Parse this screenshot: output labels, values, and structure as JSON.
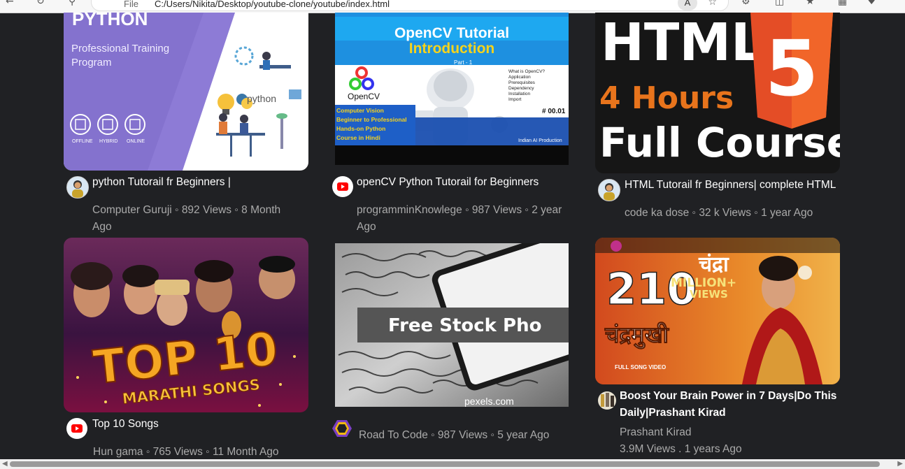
{
  "browser": {
    "file_label": "File",
    "url": "C:/Users/Nikita/Desktop/youtube-clone/youtube/index.html",
    "reader_label": "A"
  },
  "videos": [
    {
      "thumb_text": [
        "PYTHON",
        "Professional Training",
        "Program",
        "python",
        "OFFLINE",
        "HYBRID",
        "ONLINE"
      ],
      "title": "python Tutorail fr Beginners |",
      "meta": "Computer Guruji ◦ 892 Views ◦ 8 Month Ago"
    },
    {
      "thumb_text": [
        "OpenCV Tutorial",
        "Introduction",
        "Part - 1",
        "OpenCV",
        "Computer Vision",
        "Beginner to Professional",
        "Hands-on Python",
        "Course in Hindi",
        "What is OpenCV?",
        "Application",
        "Prerequisites",
        "Dependency",
        "Installation",
        "Import",
        "# 00.01",
        "Indian AI Production"
      ],
      "title": "openCV Python Tutorail for Beginners",
      "meta": "programminKnowlege ◦ 987 Views ◦ 2 year Ago"
    },
    {
      "thumb_text": [
        "HTML",
        "5",
        "4 Hours",
        "Full Course"
      ],
      "title": "HTML Tutorail fr Beginners| complete HTML",
      "meta": "code ka dose ◦ 32 k Views ◦ 1 year Ago"
    },
    {
      "thumb_text": [
        "TOP 10",
        "MARATHI SONGS"
      ],
      "title": "Top 10 Songs",
      "meta": "Hun gama ◦ 765 Views ◦ 11 Month Ago"
    },
    {
      "thumb_text": [
        "Free Stock Pho",
        "pexels.com"
      ],
      "title": "",
      "meta": "Road To Code ◦ 987 Views ◦ 5 year Ago"
    },
    {
      "thumb_text": [
        "210",
        "MILLION+",
        "VIEWS",
        "चंद्रा",
        "चंद्रमुखी",
        "FULL SONG VIDEO"
      ],
      "title_line1": "Boost Your Brain Power in 7 Days|Do This",
      "title_line2": "Daily|Prashant Kirad",
      "channel": "Prashant Kirad",
      "stats": "3.9M Views . 1 years Ago"
    }
  ],
  "colors": {
    "background": "#202124",
    "youtube_red": "#ff0000",
    "html5_orange": "#e44d26"
  }
}
